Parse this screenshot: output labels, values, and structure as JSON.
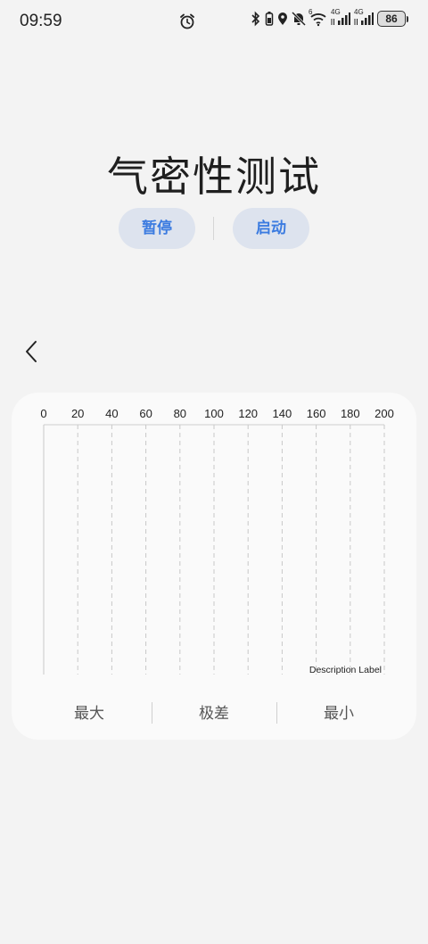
{
  "status_bar": {
    "time": "09:59",
    "network_label_1": "4G",
    "network_label_2": "4G",
    "wifi_badge": "6",
    "battery": "86",
    "icons": [
      "alarm-icon",
      "bluetooth-icon",
      "battery-saver-icon",
      "location-icon",
      "mute-icon",
      "wifi-icon",
      "signal-icon",
      "battery-icon"
    ]
  },
  "page": {
    "title": "气密性测试",
    "pause_label": "暂停",
    "start_label": "启动"
  },
  "colors": {
    "background": "#f3f3f3",
    "card": "#fafafa",
    "pill_bg": "#dde3ee",
    "accent": "#3b7be0",
    "gridline": "#c8c8c8"
  },
  "chart_data": {
    "type": "line",
    "x_ticks": [
      "0",
      "20",
      "40",
      "60",
      "80",
      "100",
      "120",
      "140",
      "160",
      "180",
      "200"
    ],
    "xlim": [
      0,
      200
    ],
    "x_axis_position": "top",
    "grid": "vertical-dashed",
    "series": [],
    "description": "Description Label"
  },
  "stats": {
    "max_label": "最大",
    "range_label": "极差",
    "min_label": "最小"
  }
}
